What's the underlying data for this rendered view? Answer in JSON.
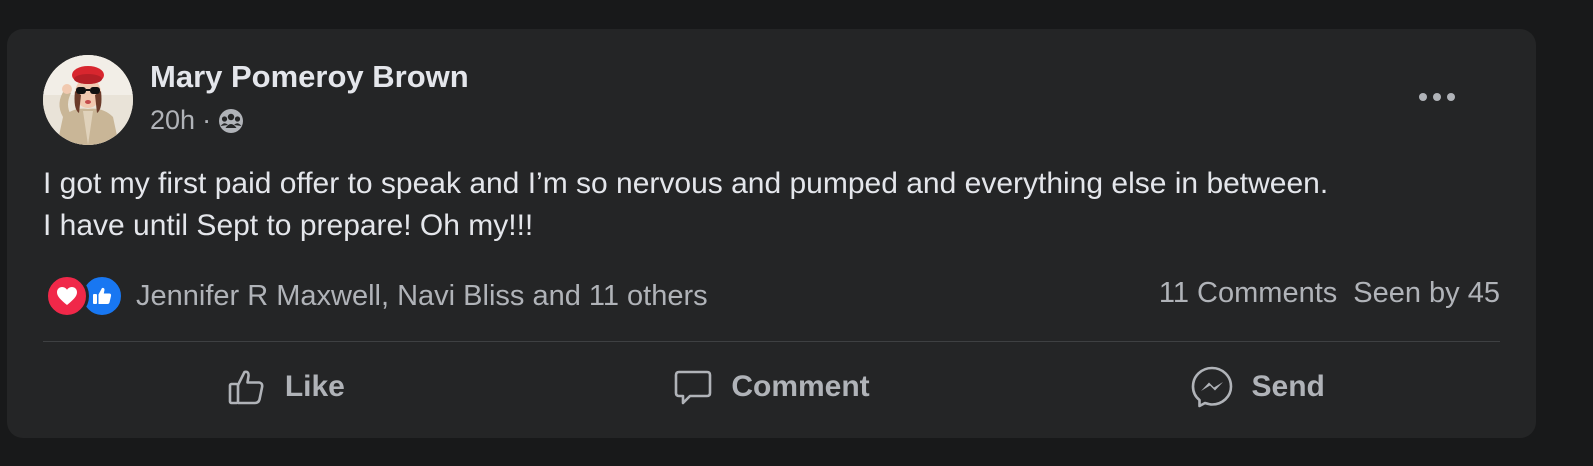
{
  "post": {
    "author": "Mary Pomeroy Brown",
    "time": "20h",
    "separator": "·",
    "audience_icon": "group-audience-icon",
    "text_lines": [
      "I got my first paid offer to speak and I’m so nervous and pumped and everything else in between.",
      "I have until Sept to prepare!  Oh my!!!"
    ],
    "reactions": {
      "icons": [
        "love-reaction-icon",
        "like-reaction-icon"
      ],
      "summary": "Jennifer R Maxwell, Navi Bliss and 11 others"
    },
    "comments": "11 Comments",
    "seen_by": "Seen by 45",
    "actions": {
      "like": "Like",
      "comment": "Comment",
      "send": "Send"
    }
  },
  "colors": {
    "page_bg": "#18191a",
    "card_bg": "#242526",
    "text_primary": "#e4e6eb",
    "text_secondary": "#b0b3b8",
    "love": "#f02849",
    "like": "#1877f2"
  }
}
